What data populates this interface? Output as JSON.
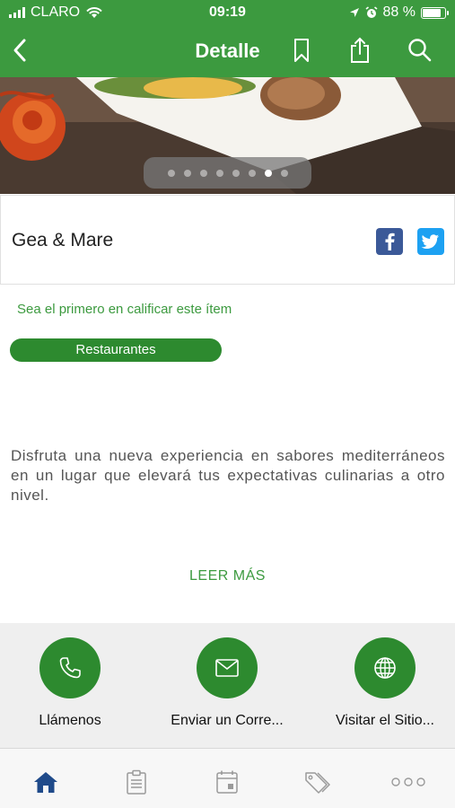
{
  "status_bar": {
    "carrier": "CLARO",
    "time": "09:19",
    "battery_percent": "88 %",
    "battery_level": 0.88
  },
  "nav": {
    "title": "Detalle",
    "back_icon": "chevron-left-icon",
    "bookmark_icon": "bookmark-icon",
    "share_icon": "share-icon",
    "search_icon": "search-icon"
  },
  "gallery": {
    "dot_count": 8,
    "active_index": 6
  },
  "place": {
    "name": "Gea & Mare",
    "social": [
      {
        "network": "facebook",
        "glyph": "f",
        "color": "#3b5998"
      },
      {
        "network": "twitter",
        "glyph": "t",
        "color": "#1da1f2"
      }
    ]
  },
  "rating_prompt": "Sea el primero en calificar este ítem",
  "category": "Restaurantes",
  "description": "Disfruta una nueva experiencia en sabores mediterráneos en un lugar que elevará tus expectativas culinarias a otro nivel.",
  "read_more": "LEER MÁS",
  "contact": [
    {
      "label": "Llámenos",
      "icon": "phone-icon"
    },
    {
      "label": "Enviar un Corre...",
      "icon": "mail-icon"
    },
    {
      "label": "Visitar el Sitio...",
      "icon": "globe-icon"
    }
  ],
  "tabs": [
    {
      "icon": "home-icon",
      "active": true
    },
    {
      "icon": "clipboard-icon",
      "active": false
    },
    {
      "icon": "calendar-icon",
      "active": false
    },
    {
      "icon": "tags-icon",
      "active": false
    },
    {
      "icon": "more-icon",
      "active": false
    }
  ],
  "colors": {
    "brand_green": "#3c9a3f",
    "button_green": "#2d8a2f",
    "tab_active": "#1f4a8a",
    "tab_inactive": "#9a9a9a"
  }
}
